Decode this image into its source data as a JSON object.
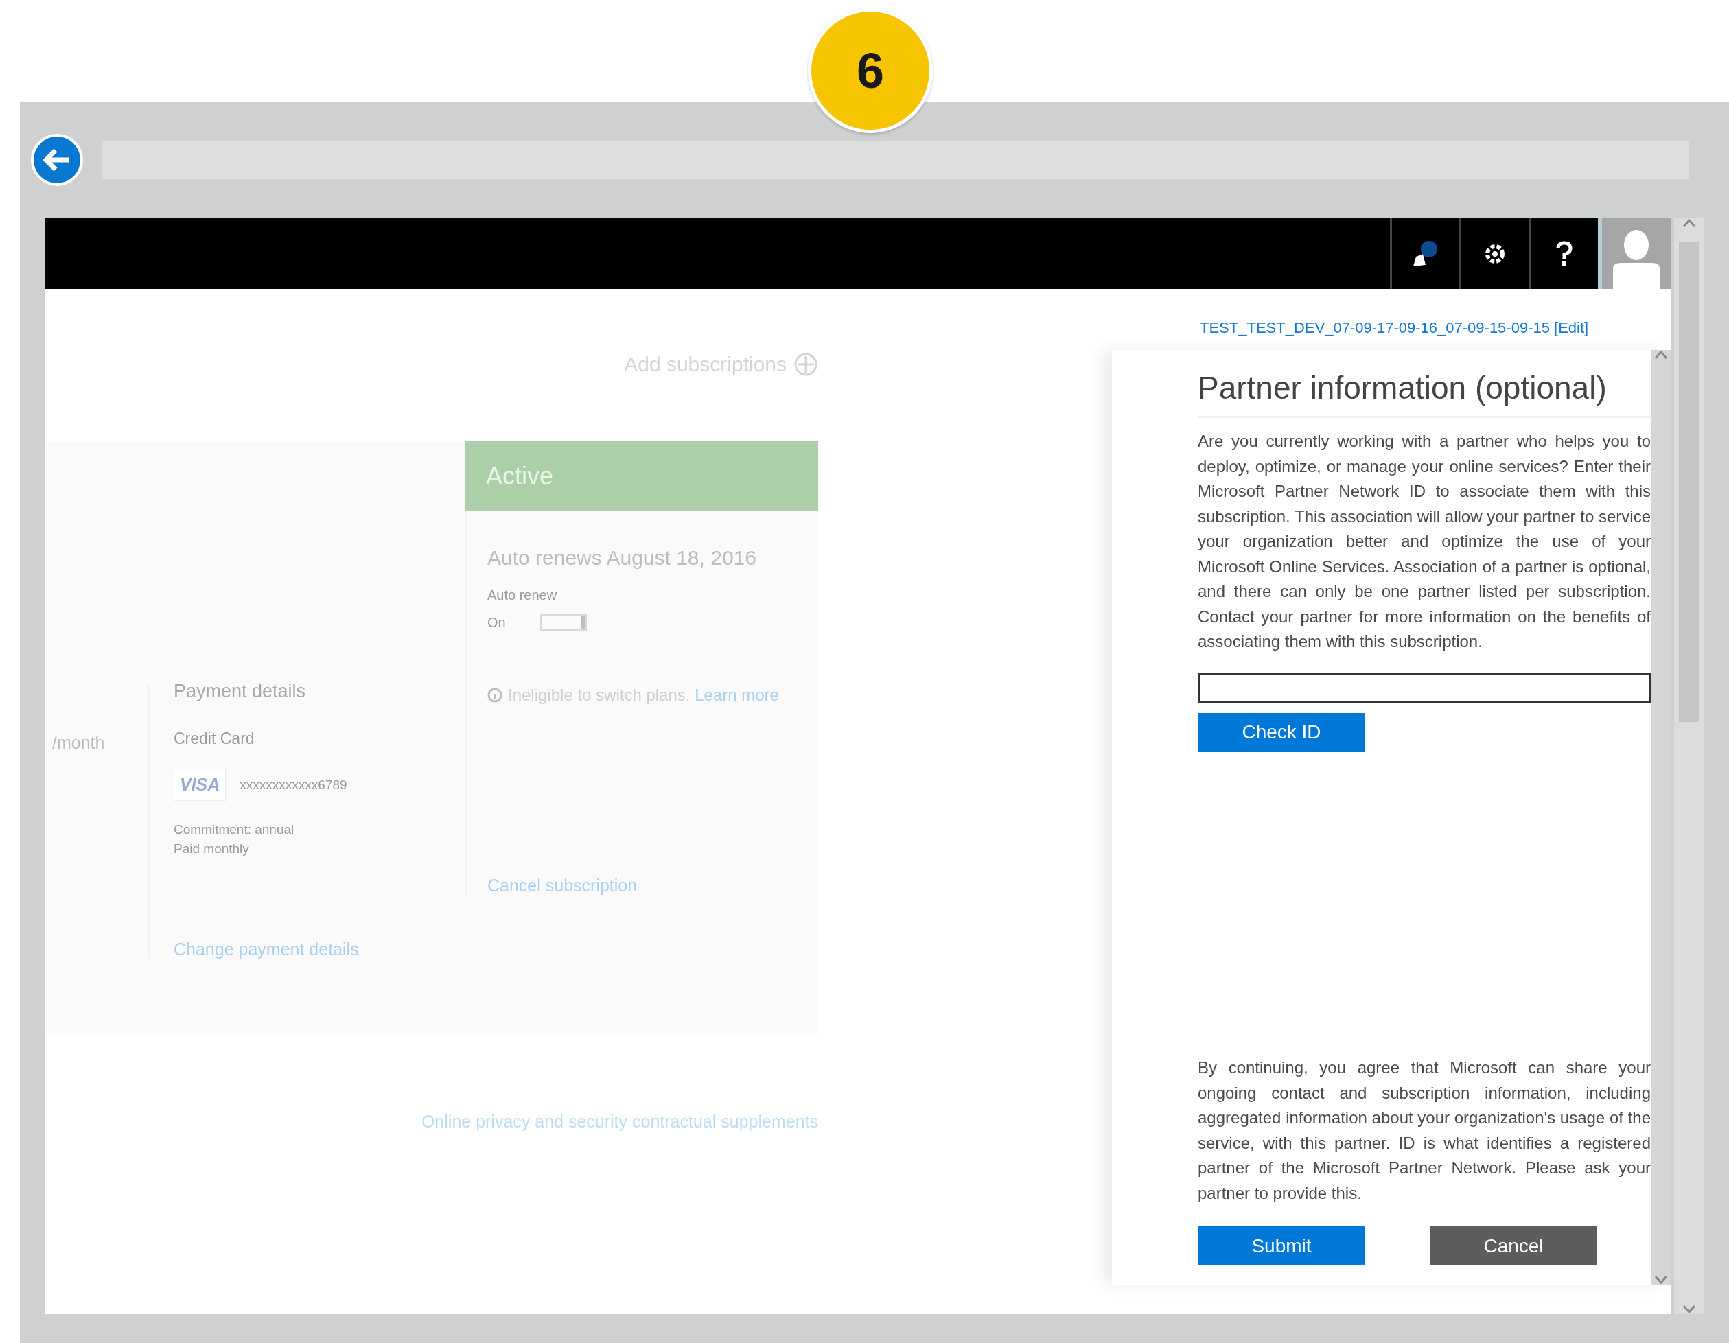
{
  "step_badge": "6",
  "account_link": "TEST_TEST_DEV_07-09-17-09-16_07-09-15-09-15 [Edit]",
  "subscription": {
    "add_label": "Add subscriptions",
    "price_suffix": "/month",
    "payment": {
      "title": "Payment details",
      "method": "Credit Card",
      "card_brand": "VISA",
      "card_number": "xxxxxxxxxxxx6789",
      "notes": [
        "Commitment: annual",
        "Paid monthly"
      ],
      "change_link": "Change payment details"
    },
    "status": {
      "label": "Active",
      "renews": "Auto renews August 18, 2016",
      "auto_renew_label": "Auto renew",
      "auto_renew_value": "On",
      "auto_renew_on": true,
      "notice": "Ineligible to switch plans.",
      "notice_link": "Learn more",
      "cancel_link": "Cancel subscription"
    }
  },
  "footer_link": "Online privacy and security contractual supplements",
  "panel": {
    "title": "Partner information (optional)",
    "intro": "Are you currently working with a partner who helps you to deploy, optimize, or manage your online services? Enter their Microsoft Partner Network ID to associate them with this subscription. This association will allow your partner to service your organization better and optimize the use of your Microsoft Online Services. Association of a partner is optional, and there can only be one partner listed per subscription. Contact your partner for more information on the benefits of associating them with this subscription.",
    "check_button": "Check ID",
    "consent": "By continuing, you agree that Microsoft can share your ongoing contact and subscription information, including aggregated information about your organization's usage of the service, with this partner. ID is what identifies a registered partner of the Microsoft Partner Network. Please ask your partner to provide this.",
    "buttons": [
      {
        "label": "Submit",
        "kind": "primary"
      },
      {
        "label": "Cancel",
        "kind": "secondary"
      }
    ]
  }
}
